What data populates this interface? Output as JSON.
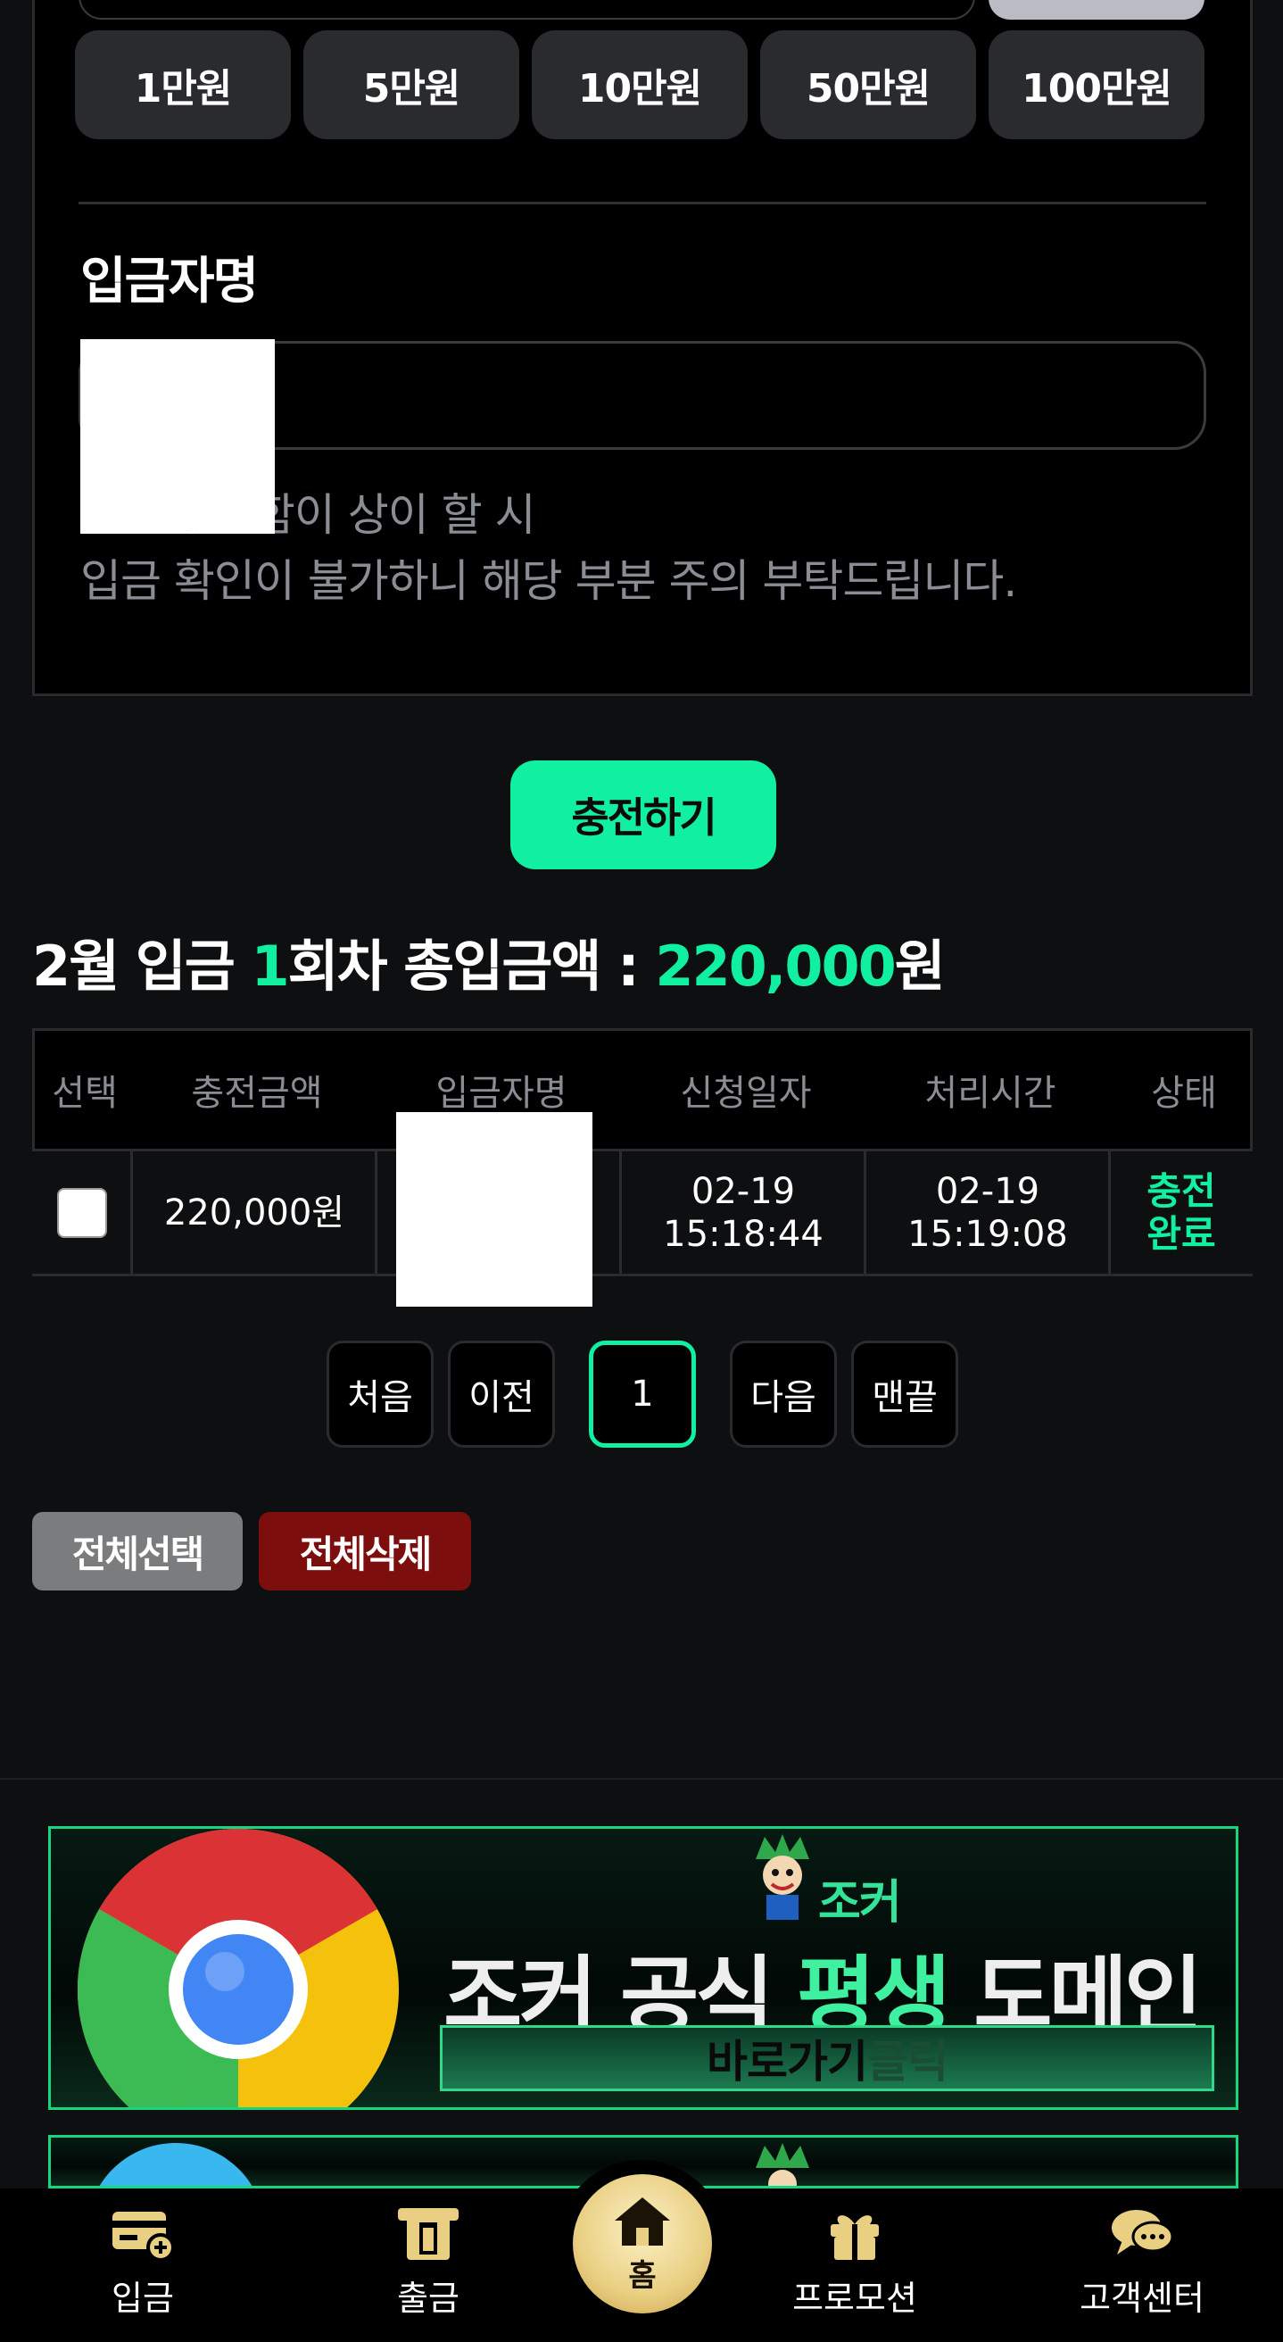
{
  "quick_amounts": [
    "1만원",
    "5만원",
    "10만원",
    "50만원",
    "100만원"
  ],
  "depositor": {
    "label": "입금자명",
    "notice_line1": "입금자 성함이 상이 할 시",
    "notice_line2": "입금 확인이 불가하니 해당 부분 주의 부탁드립니다."
  },
  "charge_button": "충전하기",
  "summary": {
    "month": "2월 입금 ",
    "count": "1",
    "count_suffix": "회차 총입금액 : ",
    "total": "220,000",
    "currency": "원"
  },
  "table": {
    "headers": [
      "선택",
      "충전금액",
      "입금자명",
      "신청일자",
      "처리시간",
      "상태"
    ],
    "rows": [
      {
        "amount": "220,000원",
        "depositor": "",
        "request_date": "02-19",
        "request_time": "15:18:44",
        "process_date": "02-19",
        "process_time": "15:19:08",
        "status_line1": "충전",
        "status_line2": "완료"
      }
    ]
  },
  "pagination": {
    "first": "처음",
    "prev": "이전",
    "current": "1",
    "next": "다음",
    "last": "맨끝"
  },
  "actions": {
    "select_all": "전체선택",
    "delete_all": "전체삭제"
  },
  "banner": {
    "brand": "조커",
    "headline_white": "조커 공식 ",
    "headline_green": "평생 ",
    "headline_tail": "도메인",
    "cta_main": "바로가기 ",
    "cta_tail": "클릭"
  },
  "nav": {
    "deposit": "입금",
    "withdraw": "출금",
    "home": "홈",
    "promotion": "프로모션",
    "support": "고객센터"
  },
  "colors": {
    "accent": "#10f0a0",
    "delete": "#7d0e0e",
    "select_all": "#7b7c7e",
    "home_gold": "#e9cf82"
  }
}
